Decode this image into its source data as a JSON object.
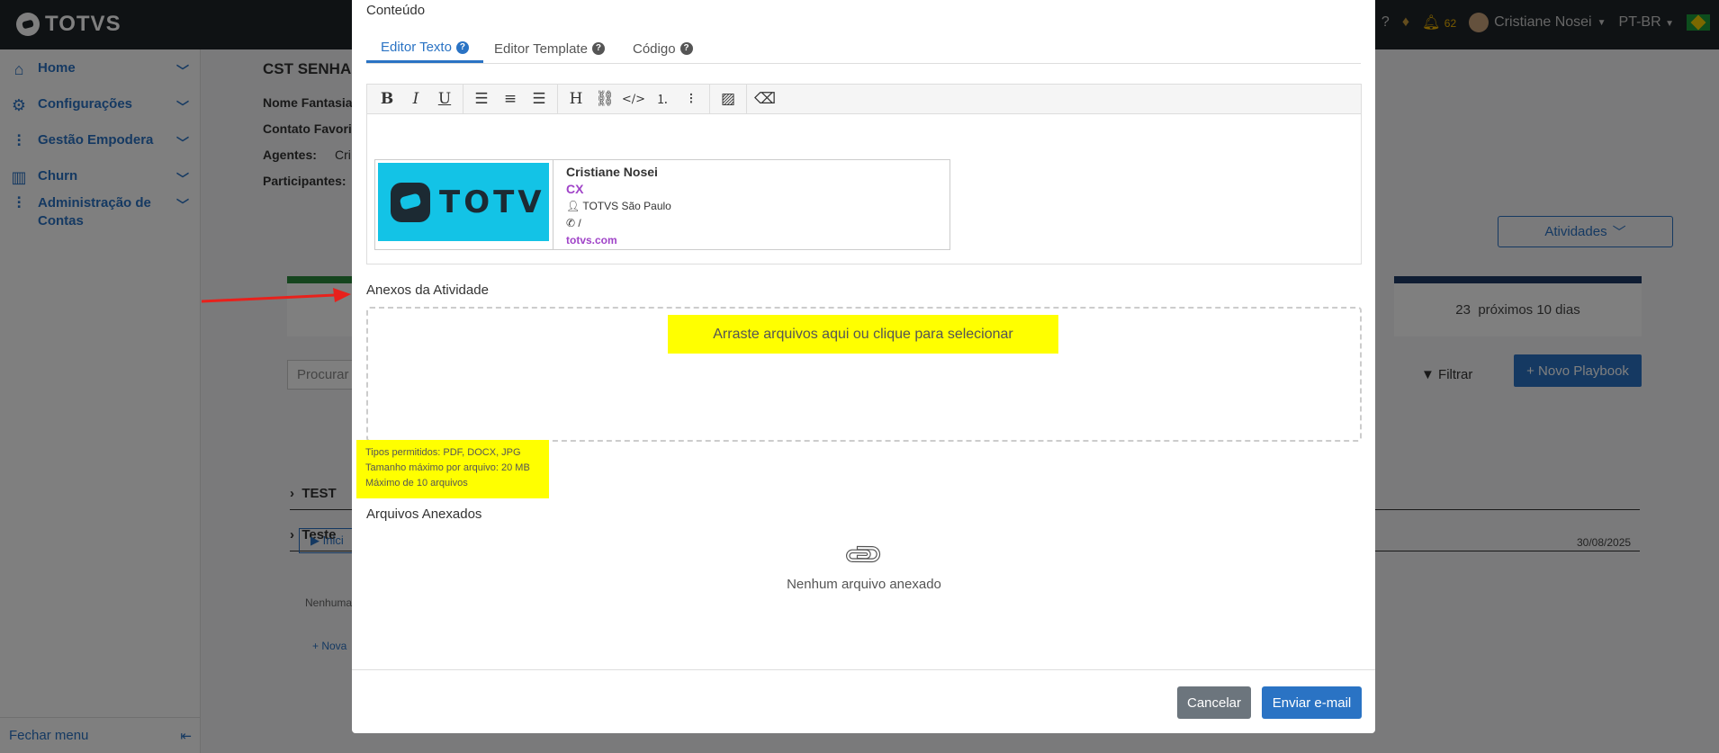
{
  "app": {
    "logo_text": "TOTVS"
  },
  "topbar": {
    "notifications_count": "62",
    "user_name": "Cristiane Nosei",
    "language": "PT-BR"
  },
  "sidebar": {
    "items": [
      {
        "label": "Home",
        "icon": "home-icon"
      },
      {
        "label": "Configurações",
        "icon": "gear-icon"
      },
      {
        "label": "Gestão Empodera",
        "icon": "sliders-icon"
      },
      {
        "label": "Churn",
        "icon": "bar-chart-icon"
      },
      {
        "label": "Administração de Contas",
        "icon": "sliders-icon"
      }
    ],
    "footer_label": "Fechar menu"
  },
  "background": {
    "title": "CST SENHA",
    "labels": [
      "Nome Fantasia",
      "Contato Favori",
      "Agentes:",
      "Participantes:"
    ],
    "agent_value": "Cri",
    "activities_button": "Atividades",
    "card_count": "23",
    "card_label": "próximos 10 dias",
    "search_placeholder": "Procurar",
    "filter_label": "Filtrar",
    "new_playbook": "Novo Playbook",
    "rows": [
      "TEST",
      "Teste"
    ],
    "start_button": "Inici",
    "date": "30/08/2025",
    "none_text": "Nenhuma",
    "new_text": "Nova"
  },
  "modal": {
    "content_title": "Conteúdo",
    "tabs": [
      {
        "label": "Editor Texto",
        "active": true
      },
      {
        "label": "Editor Template",
        "active": false
      },
      {
        "label": "Código",
        "active": false
      }
    ],
    "toolbar": [
      "B",
      "I",
      "U",
      "align-left",
      "align-center",
      "align-right",
      "H",
      "link",
      "code",
      "ordered-list",
      "bullet-list",
      "image",
      "eraser"
    ],
    "signature": {
      "logo_text": "TOTV",
      "name": "Cristiane Nosei",
      "role": "CX",
      "location": "TOTVS São Paulo",
      "phone": "/",
      "site": "totvs.com"
    },
    "attachments_title": "Anexos da Atividade",
    "dropzone_text": "Arraste arquivos aqui ou clique para selecionar",
    "hints": [
      "Tipos permitidos: PDF, DOCX, JPG",
      "Tamanho máximo por arquivo: 20 MB",
      "Máximo de 10 arquivos"
    ],
    "attached_title": "Arquivos Anexados",
    "empty_text": "Nenhum arquivo anexado",
    "cancel_label": "Cancelar",
    "send_label": "Enviar e-mail"
  },
  "colors": {
    "primary": "#2a73c4",
    "highlight": "#ffff00",
    "signature_accent": "#a044c8",
    "arrow": "#e8211c"
  }
}
